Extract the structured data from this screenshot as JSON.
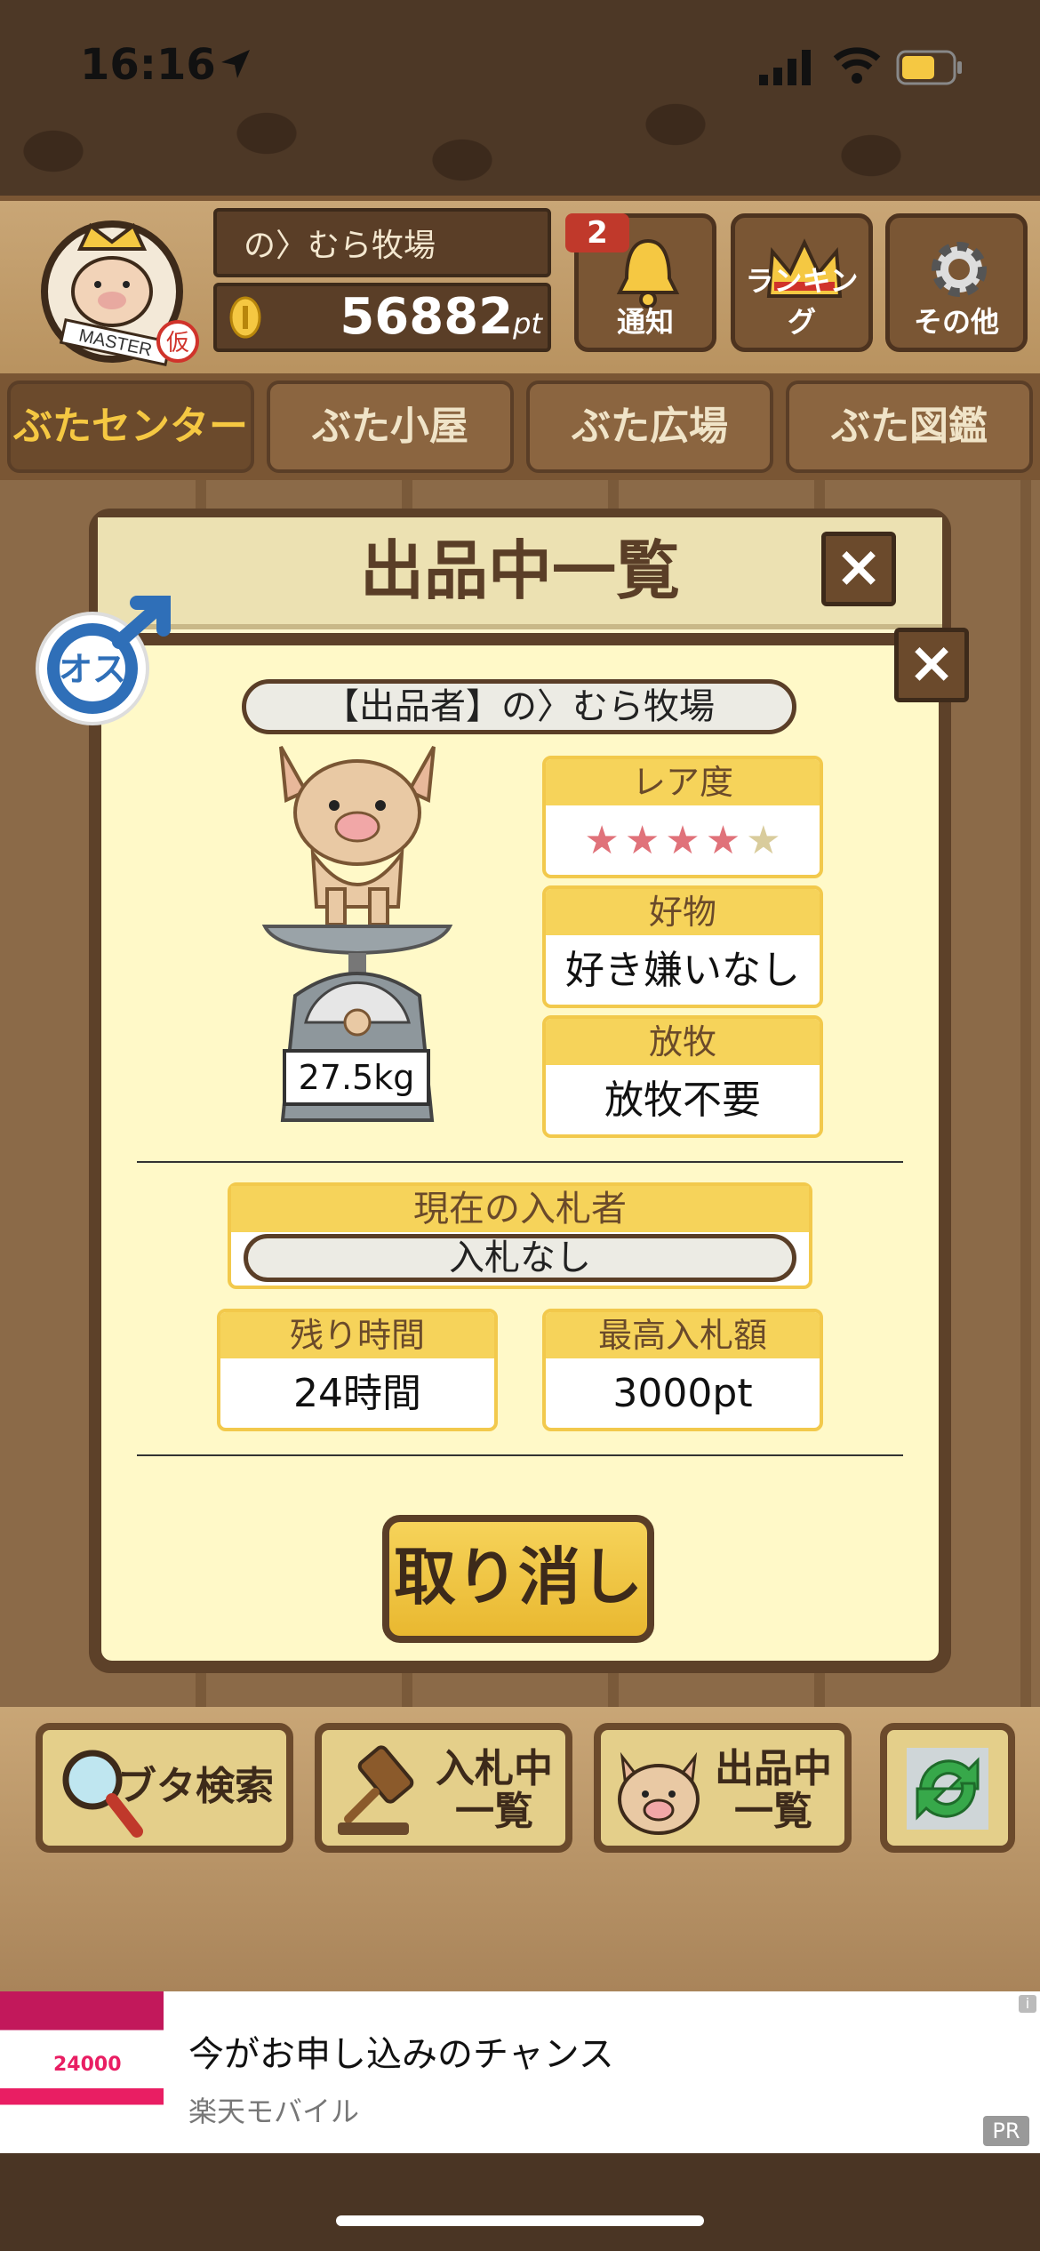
{
  "status_bar": {
    "time": "16:16"
  },
  "header": {
    "badge_text": "MASTER",
    "badge_mark": "仮",
    "farm_name": "の〉むら牧場",
    "points": "56882",
    "points_unit": "pt",
    "notifications_count": "2",
    "notifications_label": "通知",
    "ranking_label": "ランキング",
    "other_label": "その他"
  },
  "tabs": [
    {
      "label": "ぶたセンター",
      "active": true
    },
    {
      "label": "ぶた小屋"
    },
    {
      "label": "ぶた広場"
    },
    {
      "label": "ぶた図鑑"
    }
  ],
  "modal": {
    "title": "出品中一覧",
    "gender_label": "オス",
    "seller": "【出品者】の〉むら牧場",
    "weight": "27.5kg",
    "rarity_label": "レア度",
    "rarity_stars": 4,
    "rarity_max": 5,
    "favorite_label": "好物",
    "favorite_value": "好き嫌いなし",
    "grazing_label": "放牧",
    "grazing_value": "放牧不要",
    "bidder_label": "現在の入札者",
    "bidder_value": "入札なし",
    "time_left_label": "残り時間",
    "time_left_value": "24時間",
    "max_bid_label": "最高入札額",
    "max_bid_value": "3000pt",
    "cancel_label": "取り消し"
  },
  "bottom_bar": {
    "search_label": "ブタ検索",
    "bidding_label_1": "入札中",
    "bidding_label_2": "一覧",
    "listing_label_1": "出品中",
    "listing_label_2": "一覧"
  },
  "ad": {
    "title": "今がお申し込みのチャンス",
    "advertiser": "楽天モバイル",
    "pr": "PR",
    "info": "i",
    "banner_amount": "24000"
  },
  "colors": {
    "accent": "#f6d35a",
    "wood": "#5d4129",
    "star_on": "#e0727a"
  }
}
